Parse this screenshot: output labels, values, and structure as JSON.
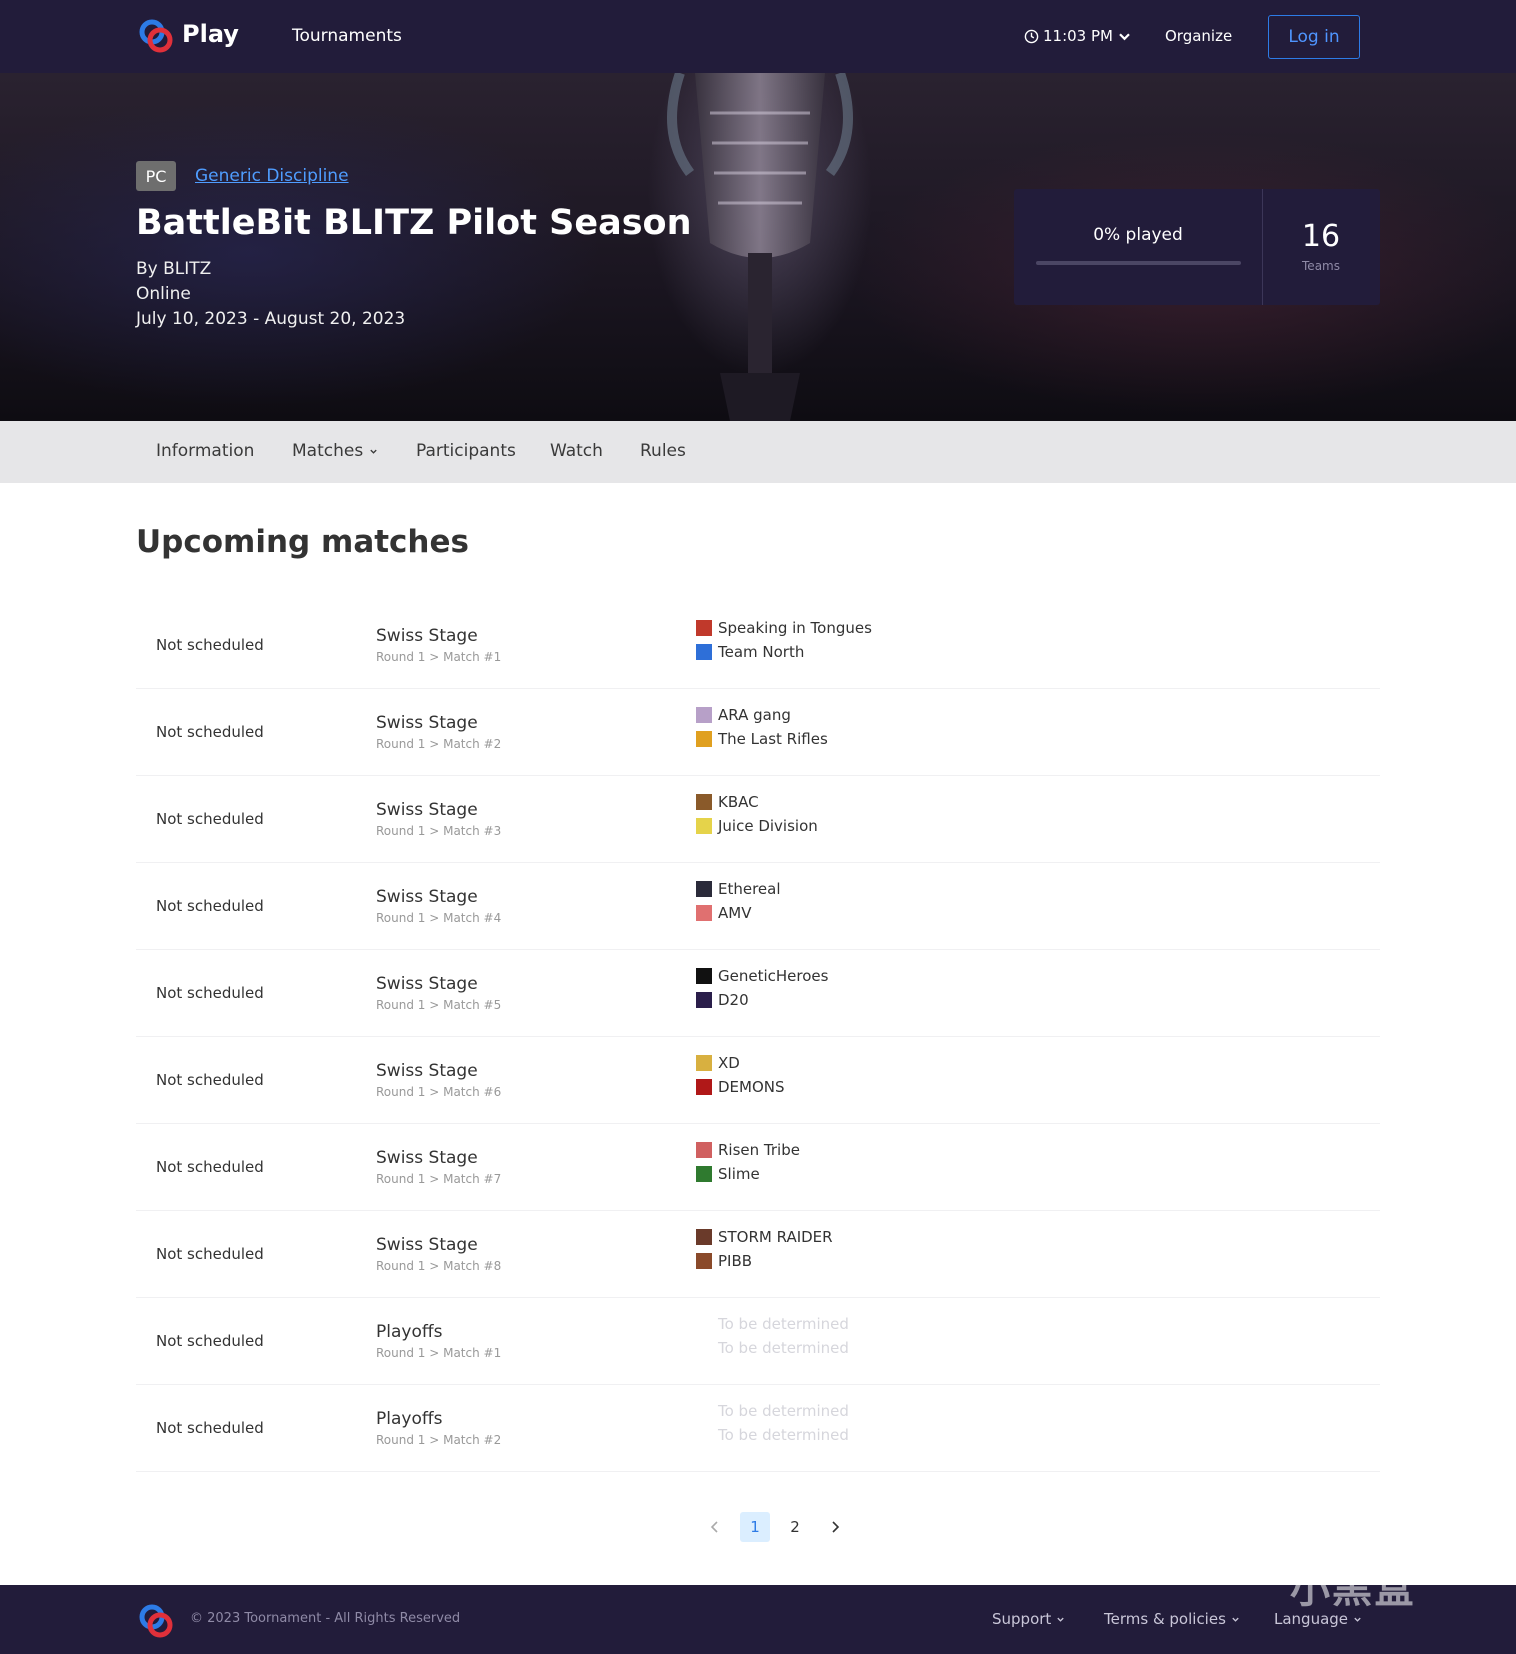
{
  "header": {
    "brand": "Play",
    "nav_tournaments": "Tournaments",
    "clock": "11:03 PM",
    "organize": "Organize",
    "login": "Log in"
  },
  "hero": {
    "platform": "PC",
    "discipline": "Generic Discipline",
    "title": "BattleBit BLITZ Pilot Season",
    "organizer": "By BLITZ",
    "location": "Online",
    "dates": "July 10, 2023 - August 20, 2023",
    "played_label": "0% played",
    "played_fraction": 0,
    "teams_count": "16",
    "teams_label": "Teams"
  },
  "tabs": [
    {
      "label": "Information"
    },
    {
      "label": "Matches"
    },
    {
      "label": "Participants"
    },
    {
      "label": "Watch"
    },
    {
      "label": "Rules"
    }
  ],
  "main": {
    "section_title": "Upcoming matches",
    "matches": [
      {
        "status": "Not scheduled",
        "stage": "Swiss Stage",
        "round": "Round 1 > Match #1",
        "team1": "Speaking in Tongues",
        "team1_color": "#c0392b",
        "team2": "Team North",
        "team2_color": "#2e6fd8",
        "tbd": false
      },
      {
        "status": "Not scheduled",
        "stage": "Swiss Stage",
        "round": "Round 1 > Match #2",
        "team1": "ARA gang",
        "team1_color": "#b7a0c8",
        "team2": "The Last Rifles",
        "team2_color": "#e0a020",
        "tbd": false
      },
      {
        "status": "Not scheduled",
        "stage": "Swiss Stage",
        "round": "Round 1 > Match #3",
        "team1": "KBAC",
        "team1_color": "#8a5a2a",
        "team2": "Juice Division",
        "team2_color": "#e5d34a",
        "tbd": false
      },
      {
        "status": "Not scheduled",
        "stage": "Swiss Stage",
        "round": "Round 1 > Match #4",
        "team1": "Ethereal",
        "team1_color": "#2b2b3a",
        "team2": "AMV",
        "team2_color": "#e07070",
        "tbd": false
      },
      {
        "status": "Not scheduled",
        "stage": "Swiss Stage",
        "round": "Round 1 > Match #5",
        "team1": "GeneticHeroes",
        "team1_color": "#111111",
        "team2": "D20",
        "team2_color": "#2a1e4a",
        "tbd": false
      },
      {
        "status": "Not scheduled",
        "stage": "Swiss Stage",
        "round": "Round 1 > Match #6",
        "team1": "XD",
        "team1_color": "#d8b040",
        "team2": "DEMONS",
        "team2_color": "#b01818",
        "tbd": false
      },
      {
        "status": "Not scheduled",
        "stage": "Swiss Stage",
        "round": "Round 1 > Match #7",
        "team1": "Risen Tribe",
        "team1_color": "#d06060",
        "team2": "Slime",
        "team2_color": "#2f7a2f",
        "tbd": false
      },
      {
        "status": "Not scheduled",
        "stage": "Swiss Stage",
        "round": "Round 1 > Match #8",
        "team1": "STORM RAIDER",
        "team1_color": "#6a3a2a",
        "team2": "PIBB",
        "team2_color": "#8a4a2a",
        "tbd": false
      },
      {
        "status": "Not scheduled",
        "stage": "Playoffs",
        "round": "Round 1 > Match #1",
        "team1": "To be determined",
        "team1_color": "#cccccc",
        "team2": "To be determined",
        "team2_color": "#cccccc",
        "tbd": true
      },
      {
        "status": "Not scheduled",
        "stage": "Playoffs",
        "round": "Round 1 > Match #2",
        "team1": "To be determined",
        "team1_color": "#cccccc",
        "team2": "To be determined",
        "team2_color": "#cccccc",
        "tbd": true
      }
    ]
  },
  "pagination": {
    "pages": [
      "1",
      "2"
    ],
    "current": "1"
  },
  "footer": {
    "copyright": "© 2023 Toornament - All Rights Reserved",
    "support": "Support",
    "terms": "Terms & policies",
    "language": "Language"
  },
  "watermark": "小黑盒",
  "colors": {
    "navy": "#221c3a",
    "accent": "#2d7be6",
    "tab_bar": "#e6e6e8"
  },
  "icons": {
    "logo": "play-logo-icon",
    "clock": "clock-icon",
    "chevron": "chevron-down-icon",
    "prev": "chevron-left-icon",
    "next": "chevron-right-icon"
  }
}
